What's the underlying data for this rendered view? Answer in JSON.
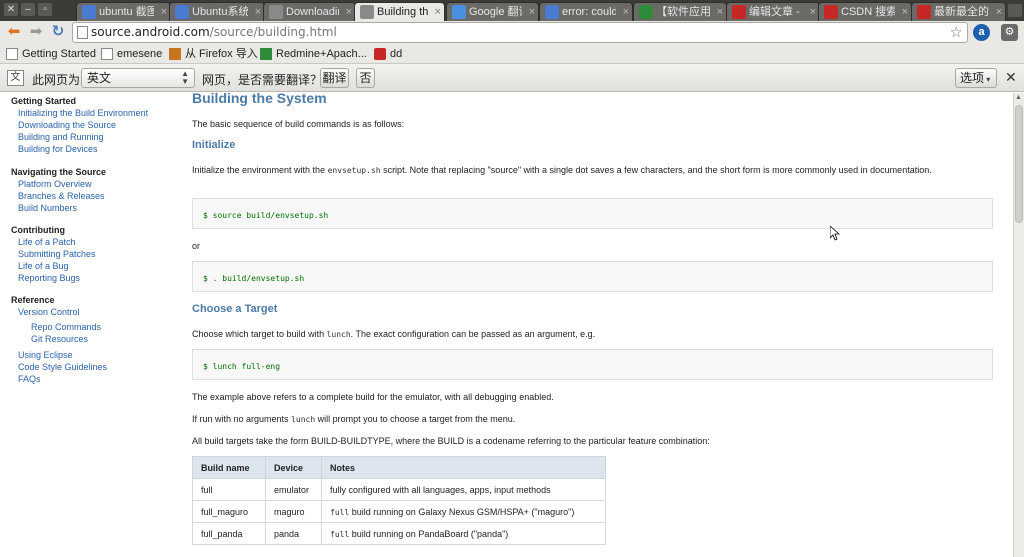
{
  "tabs": [
    {
      "label": "ubuntu 截图",
      "fav_color": "#4a7bd0",
      "active": false
    },
    {
      "label": "Ubuntu系统上",
      "fav_color": "#4a7bd0",
      "active": false
    },
    {
      "label": "Downloading",
      "fav_color": "#8a8a8a",
      "active": false
    },
    {
      "label": "Building the",
      "fav_color": "#8a8a8a",
      "active": true
    },
    {
      "label": "Google 翻译",
      "fav_color": "#4a90e2",
      "active": false
    },
    {
      "label": "error: could",
      "fav_color": "#4a7bd0",
      "active": false
    },
    {
      "label": "【软件应用】",
      "fav_color": "#2e8b3a",
      "active": false
    },
    {
      "label": "编辑文章 - 博",
      "fav_color": "#c62828",
      "active": false
    },
    {
      "label": "CSDN 搜索",
      "fav_color": "#c62828",
      "active": false
    },
    {
      "label": "最新最全的A",
      "fav_color": "#c62828",
      "active": false
    }
  ],
  "omnibox": {
    "host": "source.android.com",
    "path": "/source/building.html",
    "value": "source.android.com/source/building.html"
  },
  "bookmarks": [
    {
      "label": "Getting Started"
    },
    {
      "label": "emesene"
    },
    {
      "label": "从 Firefox 导入"
    },
    {
      "label": "Redmine+Apach..."
    },
    {
      "label": "dd"
    }
  ],
  "translate_bar": {
    "prefix": "此网页为",
    "language": "英文",
    "question": "网页，是否需要翻译？",
    "translate_label": "翻译",
    "no_label": "否",
    "options_label": "选项"
  },
  "sidebar": {
    "sections": [
      {
        "title": "Getting Started",
        "links": [
          "Initializing the Build Environment",
          "Downloading the Source",
          "Building and Running",
          "Building for Devices"
        ]
      },
      {
        "title": "Navigating the Source",
        "links": [
          "Platform Overview",
          "Branches & Releases",
          "Build Numbers"
        ]
      },
      {
        "title": "Contributing",
        "links": [
          "Life of a Patch",
          "Submitting Patches",
          "Life of a Bug",
          "Reporting Bugs"
        ]
      },
      {
        "title": "Reference",
        "links": [
          "Version Control",
          "Repo Commands",
          "Git Resources",
          "Using Eclipse",
          "Code Style Guidelines",
          "FAQs"
        ]
      }
    ]
  },
  "content": {
    "title": "Building the System",
    "intro": "The basic sequence of build commands is as follows:",
    "initialize_heading": "Initialize",
    "init_text_1": "Initialize the environment with the ",
    "init_code": "envsetup.sh",
    "init_text_2": " script. Note that replacing \"source\" with a single dot saves a few characters, and the short form is more commonly used in documentation.",
    "cmd_source": "$ source build/envsetup.sh",
    "or": "or",
    "cmd_dot": "$ . build/envsetup.sh",
    "choose_heading": "Choose a Target",
    "choose_text_1": "Choose which target to build with ",
    "choose_code": "lunch",
    "choose_text_2": ". The exact configuration can be passed as an argument, e.g.",
    "cmd_lunch": "$ lunch full-eng",
    "example_text": "The example above refers to a complete build for the emulator, with all debugging enabled.",
    "noargs_text_1": "If run with no arguments ",
    "noargs_code": "lunch",
    "noargs_text_2": " will prompt you to choose a target from the menu.",
    "targets_text": "All build targets take the form BUILD-BUILDTYPE, where the BUILD is a codename referring to the particular feature combination:"
  },
  "build_table": {
    "headers": [
      "Build name",
      "Device",
      "Notes"
    ],
    "rows": [
      {
        "name": "full",
        "device": "emulator",
        "code": "",
        "notes": "fully configured with all languages, apps, input methods"
      },
      {
        "name": "full_maguro",
        "device": "maguro",
        "code": "full",
        "notes": " build running on Galaxy Nexus GSM/HSPA+ (\"maguro\")"
      },
      {
        "name": "full_panda",
        "device": "panda",
        "code": "full",
        "notes": " build running on PandaBoard (\"panda\")"
      }
    ]
  }
}
